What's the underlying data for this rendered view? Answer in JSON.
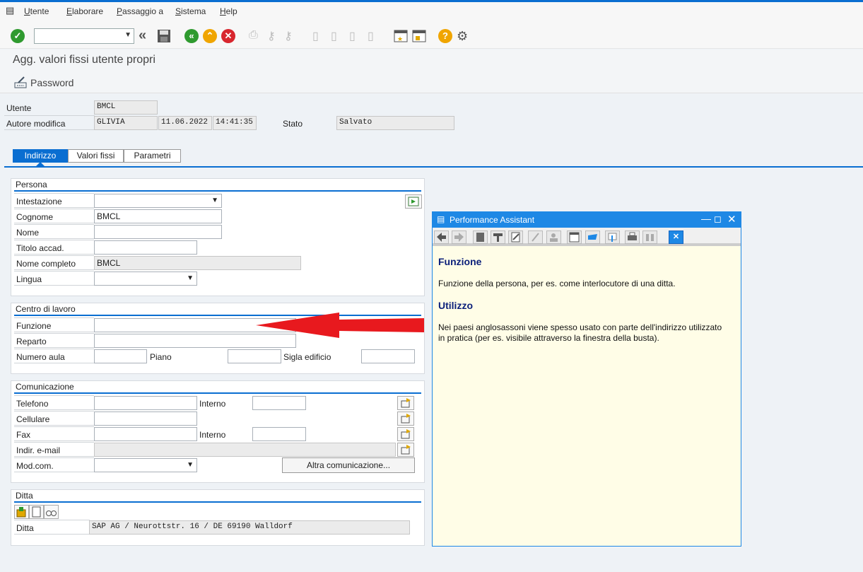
{
  "menu": [
    "Utente",
    "Elaborare",
    "Passaggio a",
    "Sistema",
    "Help"
  ],
  "page_title": "Agg. valori fissi utente propri",
  "app_toolbar": {
    "password_label": "Password"
  },
  "header_fields": {
    "utente_label": "Utente",
    "utente_value": "BMCL",
    "autore_label": "Autore modifica",
    "autore_value": "GLIVIA",
    "date": "11.06.2022",
    "time": "14:41:35",
    "stato_label": "Stato",
    "stato_value": "Salvato"
  },
  "tabs": [
    "Indirizzo",
    "Valori fissi",
    "Parametri"
  ],
  "persona": {
    "title": "Persona",
    "intestazione": "Intestazione",
    "cognome": "Cognome",
    "cognome_value": "BMCL",
    "nome": "Nome",
    "titolo": "Titolo accad.",
    "nome_completo": "Nome completo",
    "nome_completo_value": "BMCL",
    "lingua": "Lingua"
  },
  "centro": {
    "title": "Centro di lavoro",
    "funzione": "Funzione",
    "reparto": "Reparto",
    "numero_aula": "Numero aula",
    "piano": "Piano",
    "sigla": "Sigla edificio"
  },
  "comunicazione": {
    "title": "Comunicazione",
    "telefono": "Telefono",
    "interno": "Interno",
    "cellulare": "Cellulare",
    "fax": "Fax",
    "interno2": "Interno",
    "email": "Indir. e-mail",
    "modcom": "Mod.com.",
    "altra": "Altra comunicazione..."
  },
  "ditta": {
    "title": "Ditta",
    "label": "Ditta",
    "value": "SAP AG / Neurottstr. 16  / DE 69190 Walldorf"
  },
  "assistant": {
    "title": "Performance Assistant",
    "h1": "Funzione",
    "p1": "Funzione della persona, per es. come interlocutore di una ditta.",
    "h2": "Utilizzo",
    "p2": "Nei paesi anglosassoni viene spesso usato con parte dell'indirizzo utilizzato in pratica (per es. visibile attraverso la finestra della busta)."
  },
  "colors": {
    "accent": "#0a6ed1",
    "arrow": "#e8191e",
    "assistant_bg": "#fffde7"
  }
}
